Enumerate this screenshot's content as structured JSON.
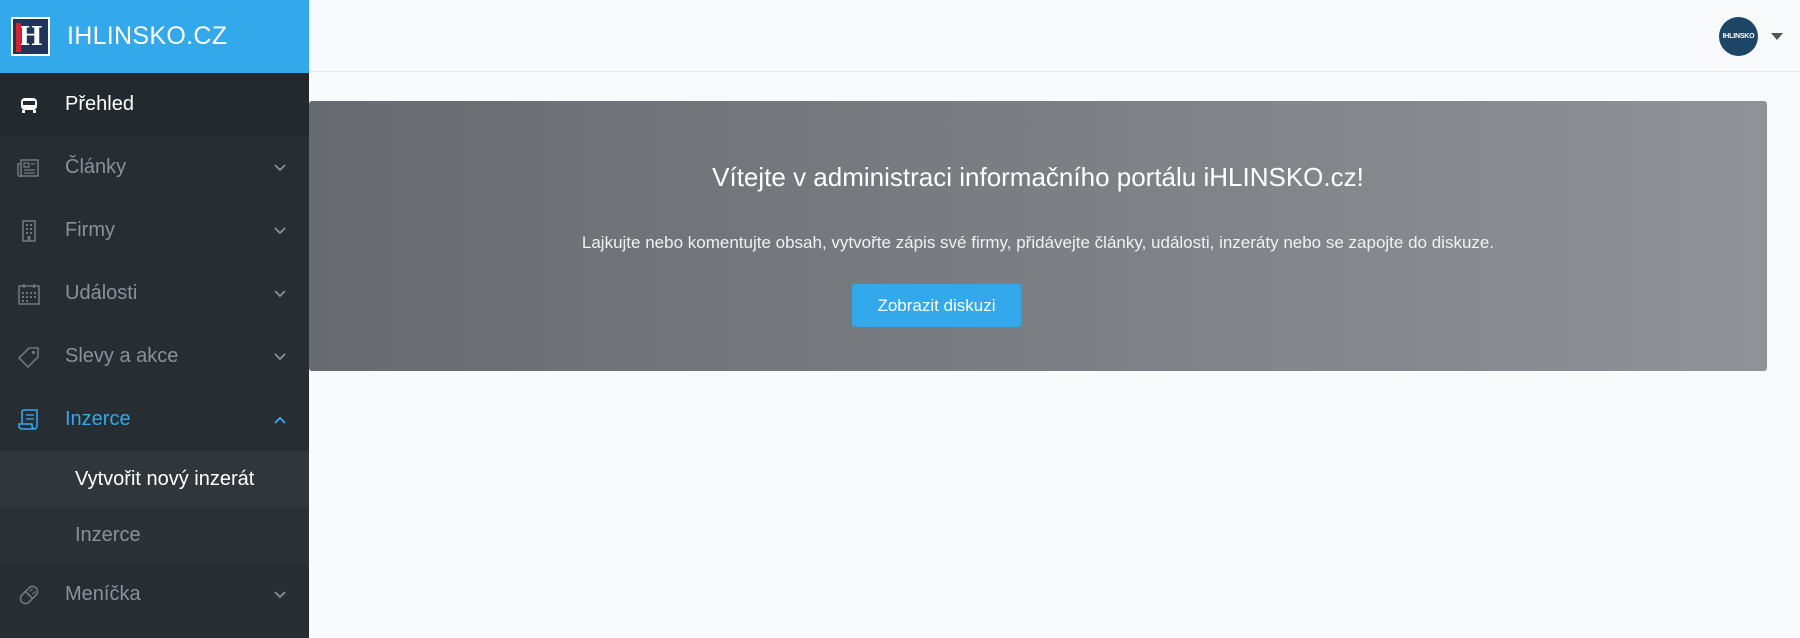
{
  "brand": {
    "logo_letter": "H",
    "title": "IHLINSKO.CZ"
  },
  "sidebar": {
    "items": [
      {
        "label": "Přehled",
        "icon": "bus-icon",
        "state": "active"
      },
      {
        "label": "Články",
        "icon": "newspaper-icon",
        "state": "collapsed"
      },
      {
        "label": "Firmy",
        "icon": "building-icon",
        "state": "collapsed"
      },
      {
        "label": "Události",
        "icon": "calendar-icon",
        "state": "collapsed"
      },
      {
        "label": "Slevy a akce",
        "icon": "tag-icon",
        "state": "collapsed"
      },
      {
        "label": "Inzerce",
        "icon": "scroll-icon",
        "state": "expanded"
      },
      {
        "label": "Meníčka",
        "icon": "pill-icon",
        "state": "collapsed"
      }
    ],
    "submenu_inzerce": [
      {
        "label": "Vytvořit nový inzerát",
        "current": true
      },
      {
        "label": "Inzerce",
        "current": false
      }
    ]
  },
  "header": {
    "avatar_text": "IHLINSKO"
  },
  "hero": {
    "title": "Vítejte v administraci informačního portálu iHLINSKO.cz!",
    "subtitle": "Lajkujte nebo komentujte obsah, vytvořte zápis své firmy, přidávejte články, události, inzeráty nebo se zapojte do diskuze.",
    "button_label": "Zobrazit diskuzi"
  },
  "colors": {
    "accent": "#33a8ea",
    "sidebar_bg": "#262d33",
    "sidebar_text": "#8a9199"
  }
}
